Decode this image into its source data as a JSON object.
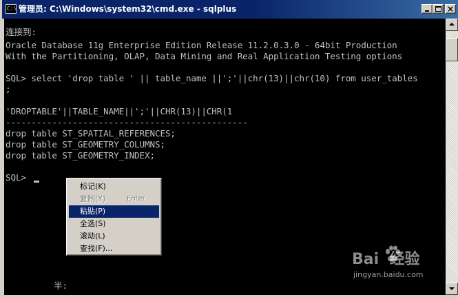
{
  "window": {
    "title": "管理员: C:\\Windows\\system32\\cmd.exe - sqlplus",
    "icon_text": "C:\\",
    "buttons": [
      "minimize",
      "maximize",
      "close"
    ],
    "close_glyph": "×"
  },
  "console": {
    "lines": [
      "连接到:",
      "Oracle Database 11g Enterprise Edition Release 11.2.0.3.0 - 64bit Production",
      "With the Partitioning, OLAP, Data Mining and Real Application Testing options",
      "",
      "SQL> select 'drop table ' || table_name ||';'||chr(13)||chr(10) from user_tables",
      ";",
      "",
      "'DROPTABLE'||TABLE_NAME||';'||CHR(13)||CHR(1",
      "-----------------------------------------------",
      "drop table ST_SPATIAL_REFERENCES;",
      "drop table ST_GEOMETRY_COLUMNS;",
      "drop table ST_GEOMETRY_INDEX;",
      "",
      "SQL> "
    ],
    "ime_indicator": "半:"
  },
  "context_menu": {
    "items": [
      {
        "label": "标记(K)",
        "accel": "",
        "state": "normal"
      },
      {
        "label": "复制(Y)",
        "accel": "Enter",
        "state": "disabled"
      },
      {
        "label": "粘贴(P)",
        "accel": "",
        "state": "highlighted"
      },
      {
        "label": "全选(S)",
        "accel": "",
        "state": "normal"
      },
      {
        "label": "滚动(L)",
        "accel": "",
        "state": "normal"
      },
      {
        "label": "查找(F)...",
        "accel": "",
        "state": "normal"
      }
    ]
  },
  "watermark": {
    "brand": "Bai  经验",
    "url": "jingyan.baidu.com"
  },
  "colors": {
    "titlebar": "#0a246a",
    "console_bg": "#000000",
    "console_fg": "#c0c0c0",
    "menu_highlight": "#0a246a"
  }
}
